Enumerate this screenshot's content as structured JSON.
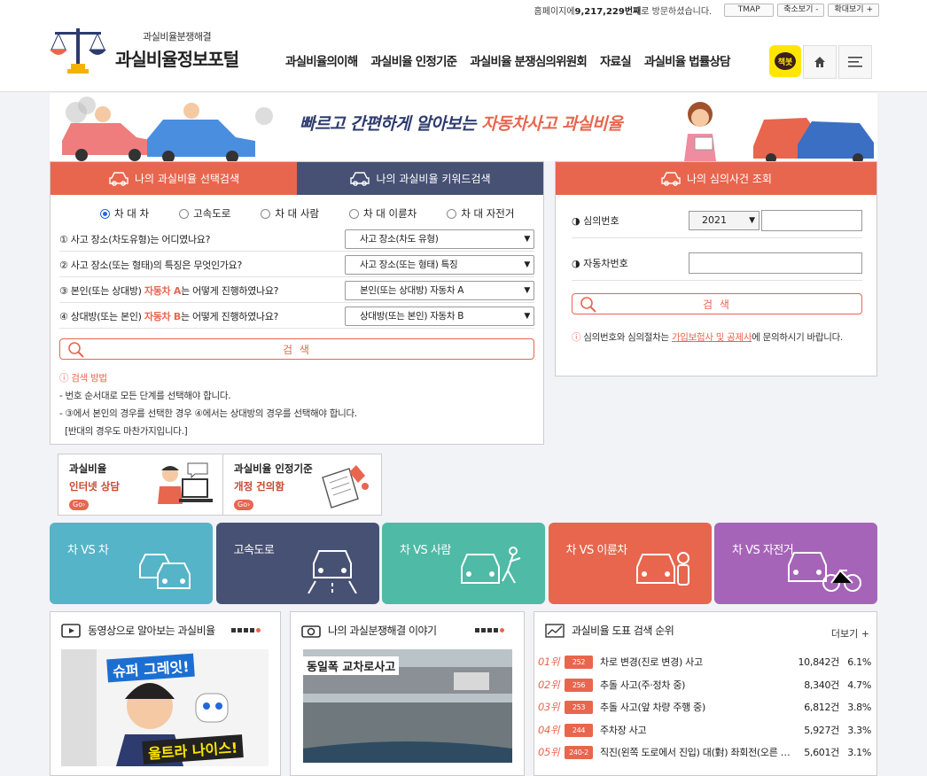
{
  "header": {
    "visit_prefix": "홈페이지에 ",
    "visit_count": "9,217,229번째",
    "visit_suffix": "로 방문하셨습니다.",
    "tmap_label": "TMAP",
    "zoom_out_label": "축소보기 -",
    "zoom_in_label": "확대보기 +",
    "logo_sub": "과실비율분쟁해결",
    "logo_main": "과실비율정보포털",
    "nav": [
      "과실비율의이해",
      "과실비율 인정기준",
      "과실비율 분쟁심의위원회",
      "자료실",
      "과실비율 법률상담"
    ],
    "kakao_label": "책봇"
  },
  "banner": {
    "slogan_prefix": "빠르고 간편하게 알아보는 ",
    "slogan_highlight": "자동차사고 과실비율"
  },
  "search": {
    "tab_select": "나의 과실비율 선택검색",
    "tab_keyword": "나의 과실비율 키워드검색",
    "radios": [
      "차 대 차",
      "고속도로",
      "차 대 사람",
      "차 대 이륜차",
      "차 대 자전거"
    ],
    "questions": [
      {
        "pre": "① 사고 장소(차도유형)는 어디였나요?",
        "hl": "",
        "post": "",
        "select": "사고 장소(차도 유형)"
      },
      {
        "pre": "② 사고 장소(또는 형태)의 특징은 무엇인가요?",
        "hl": "",
        "post": "",
        "select": "사고 장소(또는 형태) 특징"
      },
      {
        "pre": "③ 본인(또는 상대방) ",
        "hl": "자동차 A",
        "post": "는 어떻게 진행하였나요?",
        "select": "본인(또는 상대방) 자동차 A"
      },
      {
        "pre": "④ 상대방(또는 본인) ",
        "hl": "자동차 B",
        "post": "는 어떻게 진행하였나요?",
        "select": "상대방(또는 본인) 자동차 B"
      }
    ],
    "search_button": "검 색",
    "help_title": "검색 방법",
    "help_lines": [
      "- 번호 순서대로 모든 단계를 선택해야 합니다.",
      "- ③에서 본인의 경우를 선택한 경우 ④에서는 상대방의 경우를 선택해야 합니다.",
      "  [반대의 경우도 마찬가지입니다.]"
    ]
  },
  "case": {
    "title": "나의 심의사건 조회",
    "label_case_no": "심의번호",
    "year": "2021",
    "label_car_no": "자동차번호",
    "search_button": "검 색",
    "note_pre": "심의번호와 심의절차는 ",
    "note_link": "가입보험사 및 공제사",
    "note_post": "에 문의하시기 바랍니다."
  },
  "minis": [
    {
      "l1": "과실비율",
      "l2": "인터넷 상담",
      "go": "Go›"
    },
    {
      "l1": "과실비율 인정기준",
      "l2": "개정 건의함",
      "go": "Go›"
    }
  ],
  "categories": [
    {
      "label": "차 VS 차",
      "color": "#55b4c8"
    },
    {
      "label": "고속도로",
      "color": "#475174"
    },
    {
      "label": "차 VS 사람",
      "color": "#4fbaa6"
    },
    {
      "label": "차 VS 이륜차",
      "color": "#e8664e"
    },
    {
      "label": "차 VS 자전거",
      "color": "#a664b8"
    }
  ],
  "video": {
    "title": "동영상으로 알아보는 과실비율",
    "thumb_top": "슈퍼 그레잇!",
    "thumb_bottom": "울트라 나이스!"
  },
  "story": {
    "title": "나의 과실분쟁해결 이야기",
    "thumb_caption": "동일폭 교차로사고"
  },
  "ranking": {
    "title": "과실비율 도표 검색 순위",
    "more": "더보기 +",
    "rows": [
      {
        "rank": "01위",
        "code": "252",
        "name": "차로 변경(진로 변경) 사고",
        "count": "10,842건",
        "pct": "6.1%"
      },
      {
        "rank": "02위",
        "code": "256",
        "name": "추돌 사고(주·정차 중)",
        "count": "8,340건",
        "pct": "4.7%"
      },
      {
        "rank": "03위",
        "code": "253",
        "name": "추돌 사고(앞 차량 주행 중)",
        "count": "6,812건",
        "pct": "3.8%"
      },
      {
        "rank": "04위",
        "code": "244",
        "name": "주차장 사고",
        "count": "5,927건",
        "pct": "3.3%"
      },
      {
        "rank": "05위",
        "code": "240-2",
        "name": "직진(왼쪽 도로에서 진입) 대(對) 좌회전(오른 …",
        "count": "5,601건",
        "pct": "3.1%"
      }
    ]
  }
}
